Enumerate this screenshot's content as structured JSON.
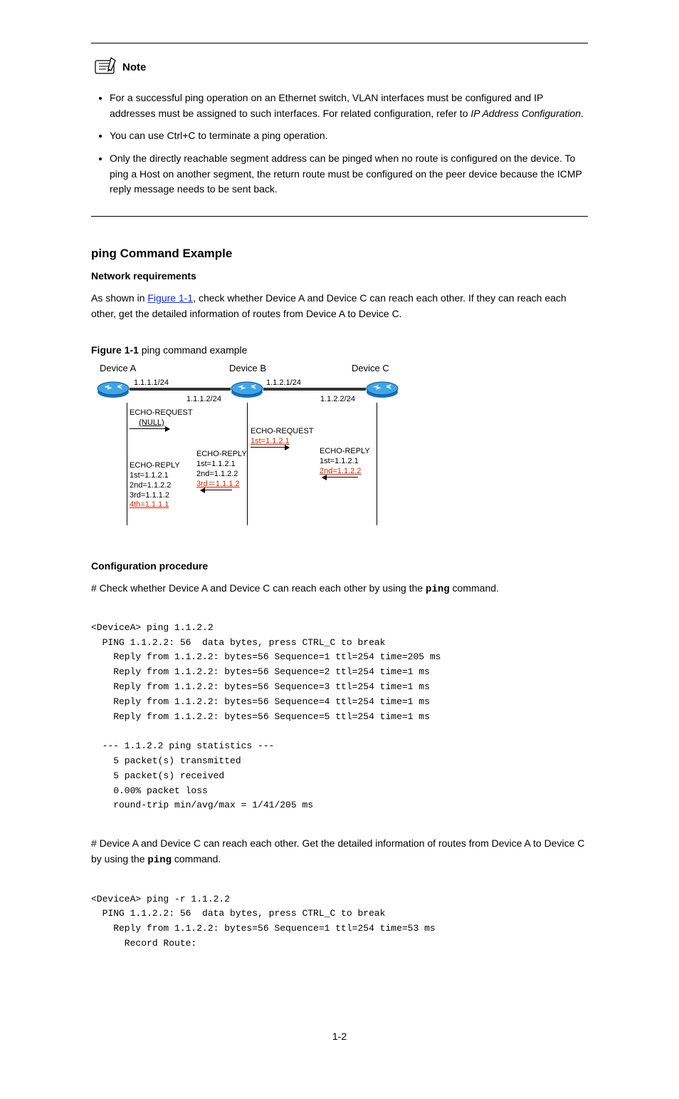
{
  "note_label": "Note",
  "bullets": [
    {
      "prefix": "For a successful ping operation on an Ethernet switch, VLAN interfaces must be configured and IP addresses must be assigned to such interfaces. For related configuration, refer to ",
      "emph": "IP Address Configuration",
      "suffix": "."
    },
    {
      "prefix": "You can use Ctrl+C to terminate a ping operation.",
      "emph": "",
      "suffix": ""
    },
    {
      "prefix": "Only the directly reachable segment address can be pinged when no route is configured on the device. To ping a Host on another segment, the return route must be configured on the peer device because the ICMP reply message needs to be sent back.",
      "emph": "",
      "suffix": ""
    }
  ],
  "section_title": "ping Command Example",
  "nr_title": "Network requirements",
  "nr_body_a": "As shown in ",
  "nr_link": "Figure 1-1",
  "nr_body_b": ", check whether Device A and Device C can reach each other. If they can reach each other, get the detailed information of routes from Device A to Device C.",
  "fig_caption_num": "Figure 1-1",
  "fig_caption_text": " ping command example",
  "diagram": {
    "devices": {
      "a": "Device A",
      "b": "Device B",
      "c": "Device C"
    },
    "ips": {
      "a_right": "1.1.1.1/24",
      "b_left": "1.1.1.2/24",
      "b_right": "1.1.2.1/24",
      "c_left": "1.1.2.2/24"
    },
    "echo_req_ab_1": "ECHO-REQUEST",
    "echo_req_ab_2": "(NULL)",
    "echo_req_bc_1": "ECHO-REQUEST",
    "echo_req_bc_2": "1st=1.1.2.1",
    "echo_reply_cb_h": "ECHO-REPLY",
    "echo_reply_cb_1": "1st=1.1.2.1",
    "echo_reply_cb_2": "2nd=1.1.2.2",
    "echo_reply_ba_h": "ECHO-REPLY",
    "echo_reply_ba_1": "1st=1.1.2.1",
    "echo_reply_ba_2": "2nd=1.1.2.2",
    "echo_reply_ba_3": "3rd＝1.1.1.2",
    "echo_reply_a_h": "ECHO-REPLY",
    "echo_reply_a_1": "1st=1.1.2.1",
    "echo_reply_a_2": "2nd=1.1.2.2",
    "echo_reply_a_3": "3rd=1.1.1.2",
    "echo_reply_a_4": "4th=1.1.1.1"
  },
  "cp_title": "Configuration procedure",
  "cp_intro": "# Check whether Device A and Device C can reach each other by using the ",
  "cp_intro_mono": "ping",
  "cp_intro_suffix": " command.",
  "cmd1": "<DeviceA> ping 1.1.2.2",
  "out": [
    "  PING 1.1.2.2: 56  data bytes, press CTRL_C to break",
    "    Reply from 1.1.2.2: bytes=56 Sequence=1 ttl=254 time=205 ms",
    "    Reply from 1.1.2.2: bytes=56 Sequence=2 ttl=254 time=1 ms",
    "    Reply from 1.1.2.2: bytes=56 Sequence=3 ttl=254 time=1 ms",
    "    Reply from 1.1.2.2: bytes=56 Sequence=4 ttl=254 time=1 ms",
    "    Reply from 1.1.2.2: bytes=56 Sequence=5 ttl=254 time=1 ms",
    "",
    "  --- 1.1.2.2 ping statistics ---",
    "    5 packet(s) transmitted",
    "    5 packet(s) received",
    "    0.00% packet loss",
    "    round-trip min/avg/max = 1/41/205 ms"
  ],
  "cp2_a": "# Device A and Device C can reach each other. Get the detailed information of routes from Device A to Device C by using the ",
  "cp2_mono": "ping",
  "cp2_b": " command.",
  "cmd2": "<DeviceA> ping -r 1.1.2.2",
  "out2": [
    "  PING 1.1.2.2: 56  data bytes, press CTRL_C to break",
    "    Reply from 1.1.2.2: bytes=56 Sequence=1 ttl=254 time=53 ms",
    "      Record Route:"
  ],
  "page_num": "1-2"
}
